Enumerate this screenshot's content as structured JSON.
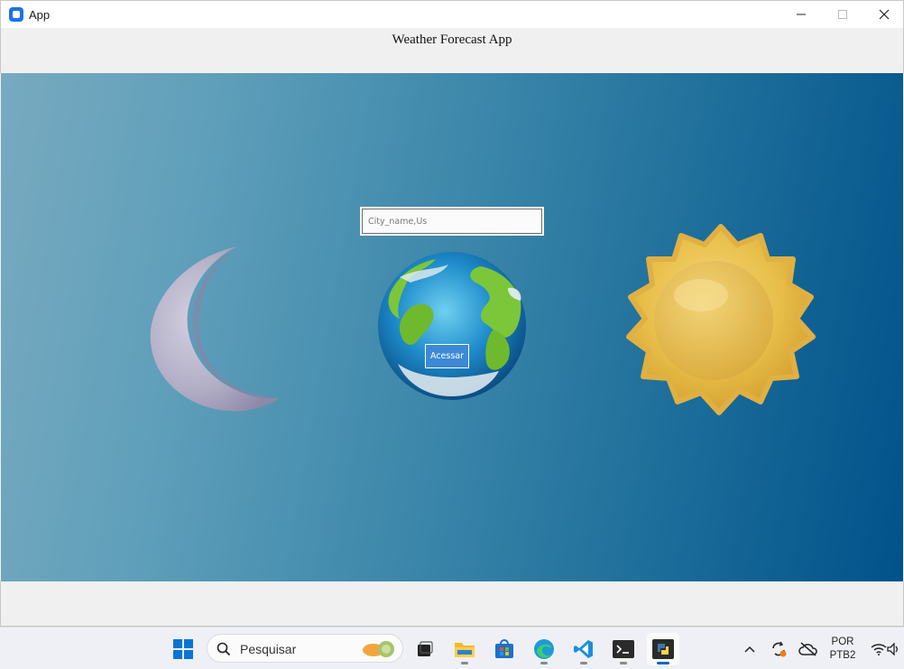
{
  "window": {
    "title": "App",
    "minimize_glyph": "—",
    "maximize_glyph": "☐",
    "close_glyph": "✕"
  },
  "app": {
    "header": "Weather Forecast App",
    "city_input": {
      "placeholder": "City_name,Us",
      "value": ""
    },
    "submit_button": "Acessar",
    "images": [
      "moon-illustration",
      "earth-globe-illustration",
      "sun-illustration"
    ],
    "colors": {
      "scene_start": "#78aac0",
      "scene_end": "#00528a",
      "button": "#3d89d6"
    }
  },
  "taskbar": {
    "search_placeholder": "Pesquisar",
    "apps": [
      "start-menu",
      "task-view",
      "file-explorer",
      "microsoft-store",
      "edge",
      "vscode",
      "terminal",
      "python"
    ],
    "active_app": "python",
    "tray": {
      "language": "POR",
      "layout": "PTB2"
    }
  }
}
